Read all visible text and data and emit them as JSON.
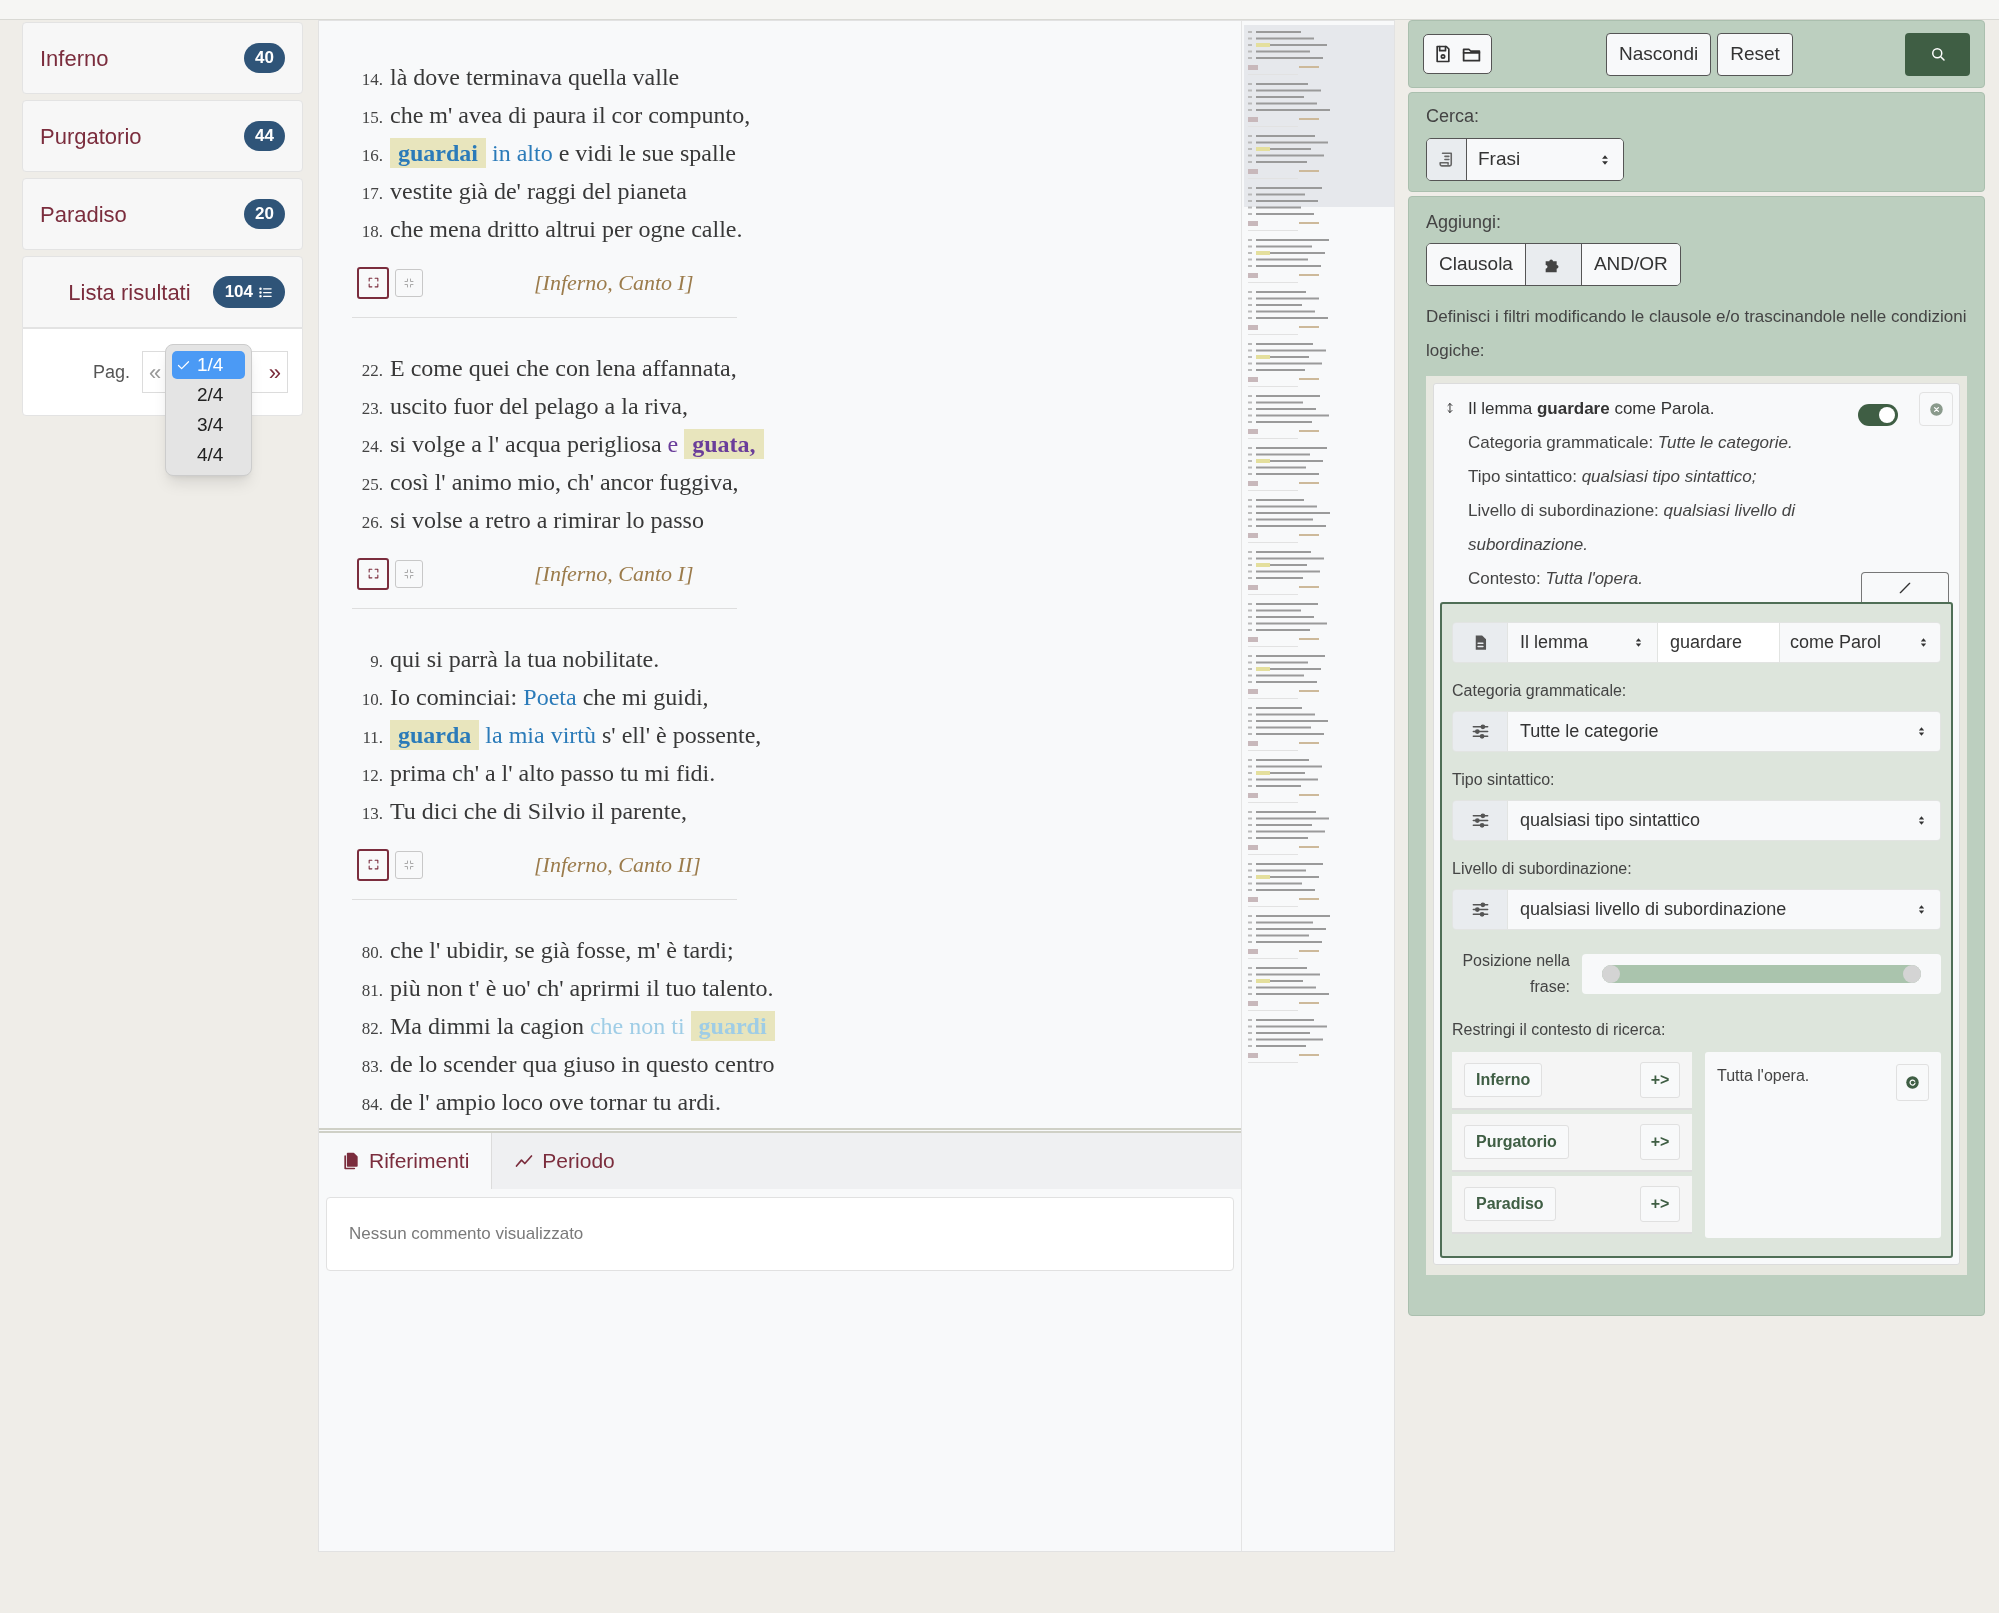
{
  "sidebar": {
    "books": [
      {
        "label": "Inferno",
        "count": "40"
      },
      {
        "label": "Purgatorio",
        "count": "44"
      },
      {
        "label": "Paradiso",
        "count": "20"
      }
    ],
    "results": {
      "label": "Lista risultati",
      "count": "104"
    },
    "pagination": {
      "label": "Pag.",
      "prev": "«",
      "next": "»",
      "options": [
        {
          "label": "1/4",
          "selected": true
        },
        {
          "label": "2/4",
          "selected": false
        },
        {
          "label": "3/4",
          "selected": false
        },
        {
          "label": "4/4",
          "selected": false
        }
      ]
    }
  },
  "passages": [
    {
      "color": "#2b7bb9",
      "reference": "[Inferno, Canto I]",
      "lines": [
        {
          "number": "14.",
          "segments": [
            {
              "kind": "plain",
              "text": "là dove terminava quella valle"
            }
          ]
        },
        {
          "number": "15.",
          "segments": [
            {
              "kind": "plain",
              "text": "che m' avea di paura il cor compunto,"
            }
          ]
        },
        {
          "number": "16.",
          "segments": [
            {
              "kind": "match",
              "text": "guardai"
            },
            {
              "kind": "context",
              "text": " in alto"
            },
            {
              "kind": "plain",
              "text": " e vidi le sue spalle"
            }
          ]
        },
        {
          "number": "17.",
          "segments": [
            {
              "kind": "plain",
              "text": "vestite già de' raggi del pianeta"
            }
          ]
        },
        {
          "number": "18.",
          "segments": [
            {
              "kind": "plain",
              "text": "che mena dritto altrui per ogne calle."
            }
          ]
        }
      ]
    },
    {
      "color": "#6a3d9a",
      "reference": "[Inferno, Canto I]",
      "lines": [
        {
          "number": "22.",
          "segments": [
            {
              "kind": "plain",
              "text": "E come quei che con lena affannata,"
            }
          ]
        },
        {
          "number": "23.",
          "segments": [
            {
              "kind": "plain",
              "text": "uscito fuor del pelago a la riva,"
            }
          ]
        },
        {
          "number": "24.",
          "segments": [
            {
              "kind": "plain",
              "text": "si volge a l' acqua perigliosa "
            },
            {
              "kind": "context",
              "text": "e "
            },
            {
              "kind": "match",
              "text": "guata,"
            }
          ]
        },
        {
          "number": "25.",
          "segments": [
            {
              "kind": "plain",
              "text": "così l' animo mio, ch' ancor fuggiva,"
            }
          ]
        },
        {
          "number": "26.",
          "segments": [
            {
              "kind": "plain",
              "text": "si volse a retro a rimirar lo passo"
            }
          ]
        }
      ]
    },
    {
      "color": "#2b7bb9",
      "reference": "[Inferno, Canto II]",
      "lines": [
        {
          "number": "9.",
          "segments": [
            {
              "kind": "plain",
              "text": "qui si parrà la tua nobilitate."
            }
          ]
        },
        {
          "number": "10.",
          "segments": [
            {
              "kind": "plain",
              "text": "Io cominciai: "
            },
            {
              "kind": "context",
              "text": "Poeta"
            },
            {
              "kind": "plain",
              "text": " che mi guidi,"
            }
          ]
        },
        {
          "number": "11.",
          "segments": [
            {
              "kind": "match",
              "text": "guarda"
            },
            {
              "kind": "context",
              "text": " la mia virtù"
            },
            {
              "kind": "plain",
              "text": " s' ell' è possente,"
            }
          ]
        },
        {
          "number": "12.",
          "segments": [
            {
              "kind": "plain",
              "text": "prima ch' a l' alto passo tu mi fidi."
            }
          ]
        },
        {
          "number": "13.",
          "segments": [
            {
              "kind": "plain",
              "text": "Tu dici che di Silvio il parente,"
            }
          ]
        }
      ]
    },
    {
      "color": "#9fcde6",
      "lines": [
        {
          "number": "80.",
          "segments": [
            {
              "kind": "plain",
              "text": "che l' ubidir, se già fosse, m' è tardi;"
            }
          ]
        },
        {
          "number": "81.",
          "segments": [
            {
              "kind": "plain",
              "text": "più non t' è uo' ch' aprirmi il tuo talento."
            }
          ]
        },
        {
          "number": "82.",
          "segments": [
            {
              "kind": "plain",
              "text": "Ma dimmi la cagion "
            },
            {
              "kind": "context",
              "text": "che non ti "
            },
            {
              "kind": "match",
              "text": "guardi"
            }
          ]
        },
        {
          "number": "83.",
          "segments": [
            {
              "kind": "plain",
              "text": "de lo scender qua giuso in questo centro"
            }
          ]
        },
        {
          "number": "84.",
          "segments": [
            {
              "kind": "plain",
              "text": "de l' ampio loco ove tornar tu ardi."
            }
          ]
        }
      ]
    }
  ],
  "bottom_tabs": [
    {
      "label": "Riferimenti",
      "selected": true
    },
    {
      "label": "Periodo",
      "selected": false
    }
  ],
  "comment_message": "Nessun commento visualizzato",
  "search_panel": {
    "toolbar": {
      "buttons": [
        "Nascondi",
        "Reset"
      ]
    },
    "search_label": "Cerca:",
    "search_select": "Frasi",
    "add_label": "Aggiungi:",
    "add_buttons": [
      {
        "kind": "text",
        "label": "Clausola"
      },
      {
        "kind": "icon"
      },
      {
        "kind": "text",
        "label": "AND/OR"
      }
    ],
    "description": "Definisci i filtri modificando le clausole e/o trascinandole nelle condizioni logiche:",
    "clause": {
      "enabled": true,
      "summary": "Il lemma **guardare** come Parola.",
      "details": [
        "Categoria grammaticale: *Tutte le categorie.*",
        "Tipo sintattico: *qualsiasi tipo sintattico;*",
        "Livello di subordinazione: *qualsiasi livello di subordinazione.*",
        "Contesto: *Tutta l'opera.*"
      ],
      "editor": {
        "lemma_select": "Il lemma",
        "lemma_value": "guardare",
        "as_select": "come Parol",
        "filters": [
          {
            "label": "Categoria grammaticale:",
            "value": "Tutte le categorie"
          },
          {
            "label": "Tipo sintattico:",
            "value": "qualsiasi tipo sintattico"
          },
          {
            "label": "Livello di subordinazione:",
            "value": "qualsiasi livello di subordinazione"
          }
        ],
        "position": {
          "label": "Posizione nella frase:",
          "level": 1
        },
        "context_label": "Restringi il contesto di ricerca:",
        "context_books": [
          {
            "label": "Inferno",
            "add": "+>"
          },
          {
            "label": "Purgatorio",
            "add": "+>"
          },
          {
            "label": "Paradiso",
            "add": "+>"
          }
        ],
        "context_selected": "Tutta l'opera."
      }
    }
  }
}
